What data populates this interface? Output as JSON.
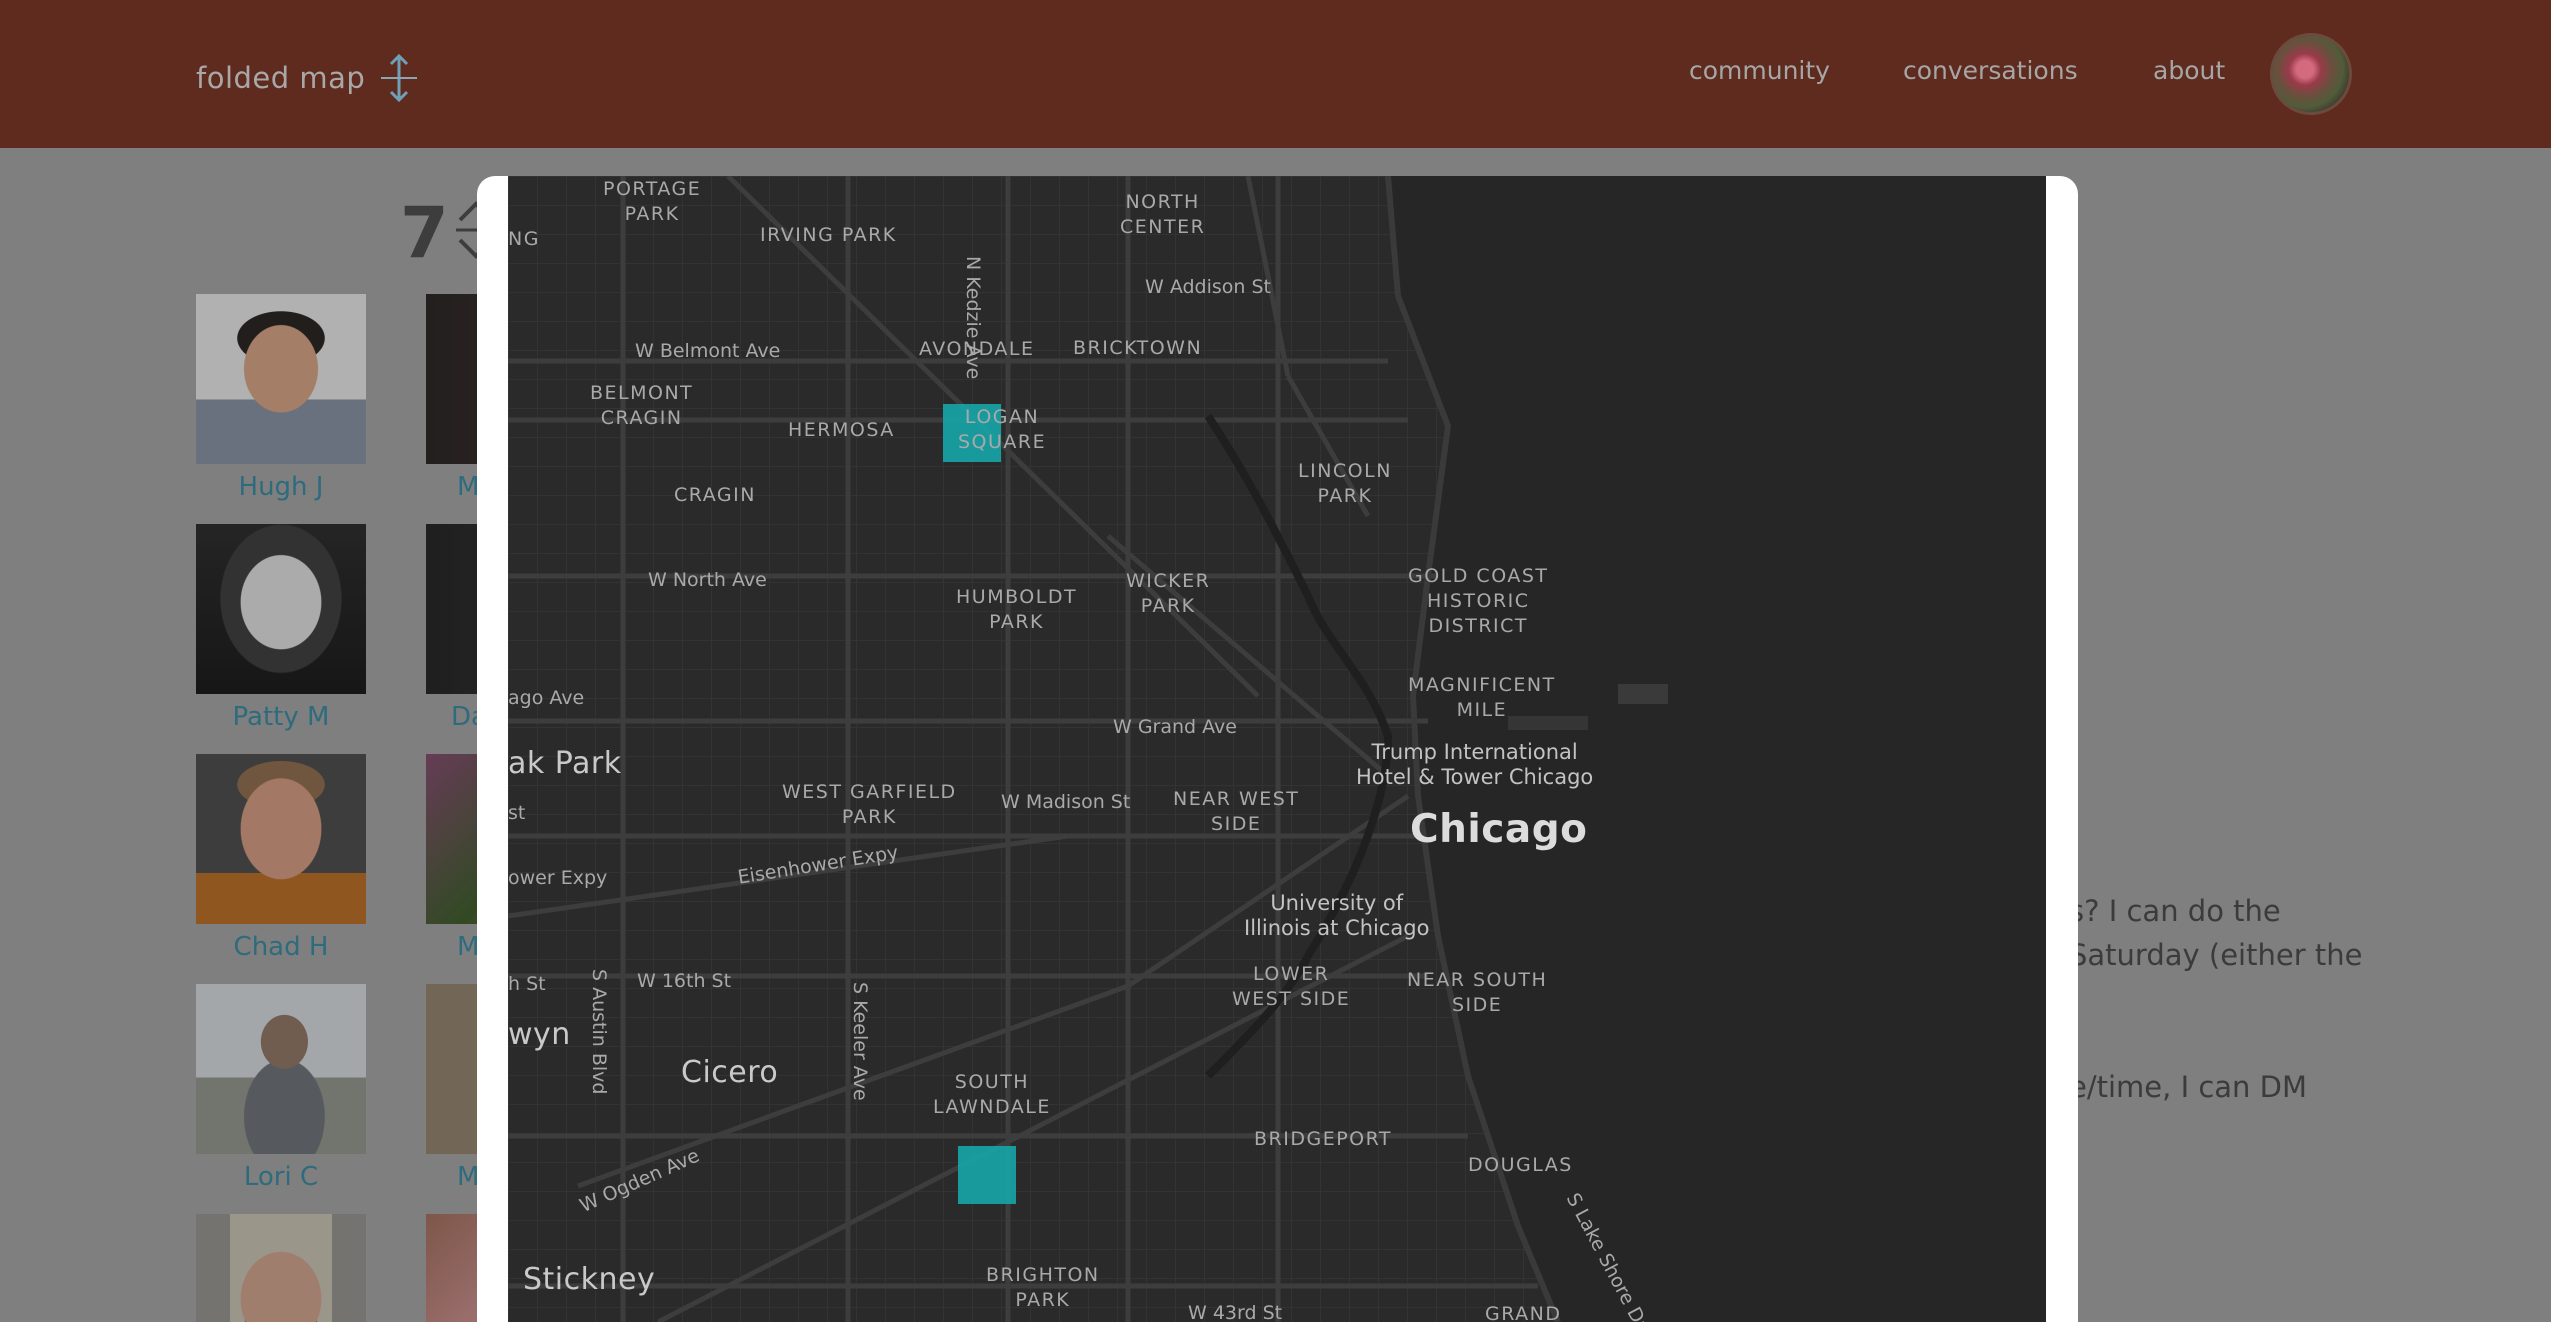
{
  "header": {
    "brand": "folded map",
    "nav": [
      "community",
      "conversations",
      "about"
    ]
  },
  "community": {
    "count": "7",
    "members": [
      {
        "name": "Hugh J"
      },
      {
        "name": "Patty M"
      },
      {
        "name": "Chad H"
      },
      {
        "name": "Lori C"
      }
    ],
    "partial_names": [
      "M",
      "Da",
      "M",
      "M"
    ]
  },
  "conversation": {
    "lines": [
      "s? I can do the",
      "Saturday (either the",
      "e/time, I can DM"
    ]
  },
  "map": {
    "neighborhoods": [
      "PORTAGE\nPARK",
      "IRVING PARK",
      "NORTH\nCENTER",
      "AVONDALE",
      "BRICKTOWN",
      "BELMONT\nCRAGIN",
      "HERMOSA",
      "LOGAN\nSQUARE",
      "LINCOLN\nPARK",
      "CRAGIN",
      "HUMBOLDT\nPARK",
      "WICKER\nPARK",
      "GOLD COAST\nHISTORIC\nDISTRICT",
      "MAGNIFICENT\nMILE",
      "WEST GARFIELD\nPARK",
      "NEAR WEST\nSIDE",
      "LOWER\nWEST SIDE",
      "NEAR SOUTH\nSIDE",
      "SOUTH\nLAWNDALE",
      "BRIDGEPORT",
      "DOUGLAS",
      "BRIGHTON\nPARK",
      "GRAND",
      "NG"
    ],
    "streets": [
      "N Kedzie Ave",
      "W Addison St",
      "W Belmont Ave",
      "W North Ave",
      "ago Ave",
      "W Grand Ave",
      "W Madison St",
      "Eisenhower Expy",
      "ower Expy",
      "st",
      "h St",
      "W 16th St",
      "S Austin Blvd",
      "S Keeler Ave",
      "W Ogden Ave",
      "S Lake Shore Dr",
      "W 43rd St"
    ],
    "places": [
      "ak Park",
      "Cicero",
      "wyn",
      "Stickney"
    ],
    "city": "Chicago",
    "pois": [
      "Trump International\nHotel & Tower Chicago",
      "University of\nIllinois at Chicago"
    ],
    "highlight_color": "#17a3a6"
  }
}
